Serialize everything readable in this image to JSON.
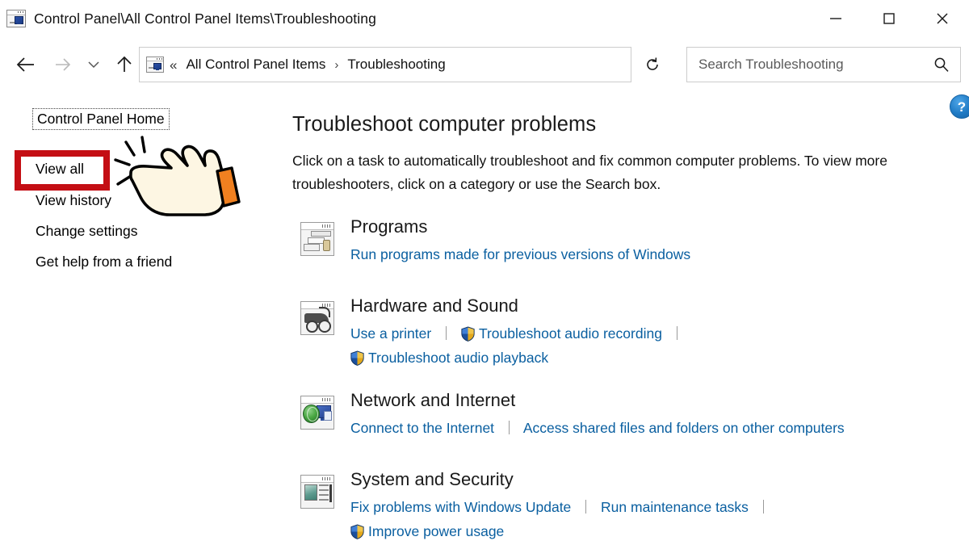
{
  "window": {
    "title": "Control Panel\\All Control Panel Items\\Troubleshooting",
    "title_icon": "control-panel-icon",
    "minimize_label": "—",
    "maximize_label": "□",
    "close_label": "✕"
  },
  "nav": {
    "back_icon": "back-arrow-icon",
    "forward_icon": "forward-arrow-icon",
    "recent_icon": "chevron-down-icon",
    "up_icon": "up-arrow-icon",
    "address_icon": "control-panel-icon",
    "address_chevrons": "«",
    "breadcrumbs": [
      {
        "label": "All Control Panel Items"
      },
      {
        "label": "Troubleshooting"
      }
    ],
    "breadcrumb_separator": "›",
    "dropdown_icon": "chevron-down-icon",
    "refresh_icon": "refresh-icon"
  },
  "search": {
    "placeholder": "Search Troubleshooting",
    "value": "",
    "icon": "search-icon"
  },
  "help": {
    "label": "?",
    "icon": "help-circle-icon"
  },
  "sidebar": {
    "home_label": "Control Panel Home",
    "items": [
      {
        "label": "View all",
        "highlighted": true
      },
      {
        "label": "View history",
        "highlighted": false
      },
      {
        "label": "Change settings",
        "highlighted": false
      },
      {
        "label": "Get help from a friend",
        "highlighted": false
      }
    ]
  },
  "annotation": {
    "highlight_color": "#C40E14",
    "cursor_icon": "pointing-hand-cursor",
    "cursor_cuff_color": "#F08020",
    "cursor_fill_color": "#FDF6E3"
  },
  "main": {
    "heading": "Troubleshoot computer problems",
    "description": "Click on a task to automatically troubleshoot and fix common computer problems. To view more troubleshooters, click on a category or use the Search box.",
    "categories": [
      {
        "title": "Programs",
        "icon": "programs-icon",
        "rows": [
          [
            {
              "label": "Run programs made for previous versions of Windows",
              "shield": false,
              "divider_after": false
            }
          ]
        ]
      },
      {
        "title": "Hardware and Sound",
        "icon": "hardware-and-sound-icon",
        "rows": [
          [
            {
              "label": "Use a printer",
              "shield": false,
              "divider_after": true
            },
            {
              "label": "Troubleshoot audio recording",
              "shield": true,
              "divider_after": true
            }
          ],
          [
            {
              "label": "Troubleshoot audio playback",
              "shield": true,
              "divider_after": false
            }
          ]
        ]
      },
      {
        "title": "Network and Internet",
        "icon": "network-and-internet-icon",
        "rows": [
          [
            {
              "label": "Connect to the Internet",
              "shield": false,
              "divider_after": true
            },
            {
              "label": "Access shared files and folders on other computers",
              "shield": false,
              "divider_after": false
            }
          ]
        ]
      },
      {
        "title": "System and Security",
        "icon": "system-and-security-icon",
        "rows": [
          [
            {
              "label": "Fix problems with Windows Update",
              "shield": false,
              "divider_after": true
            },
            {
              "label": "Run maintenance tasks",
              "shield": false,
              "divider_after": true
            }
          ],
          [
            {
              "label": "Improve power usage",
              "shield": true,
              "divider_after": false
            }
          ]
        ]
      }
    ]
  },
  "colors": {
    "link": "#0A5FA0",
    "accent_red": "#C40E14",
    "help_blue": "#1F7AC4"
  }
}
